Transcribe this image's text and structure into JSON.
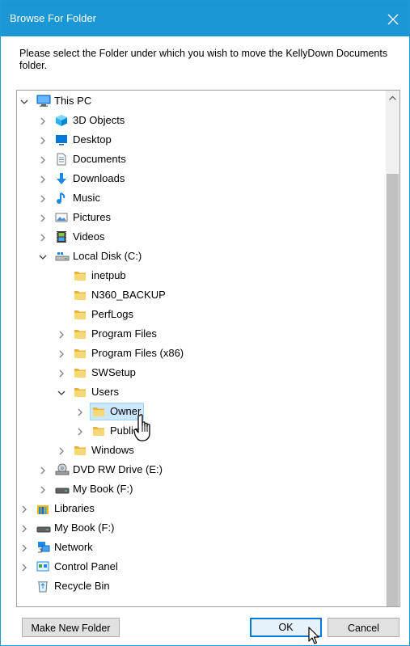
{
  "window": {
    "title": "Browse For Folder",
    "close_glyph": "✕"
  },
  "prompt": "Please select the Folder under which you wish to move the KellyDown Documents folder.",
  "tree": [
    {
      "label": "This PC",
      "level": 0,
      "state": "expanded",
      "icon": "pc-icon"
    },
    {
      "label": "3D Objects",
      "level": 1,
      "state": "collapsed",
      "icon": "3d-objects-icon"
    },
    {
      "label": "Desktop",
      "level": 1,
      "state": "collapsed",
      "icon": "desktop-icon"
    },
    {
      "label": "Documents",
      "level": 1,
      "state": "collapsed",
      "icon": "documents-icon"
    },
    {
      "label": "Downloads",
      "level": 1,
      "state": "collapsed",
      "icon": "downloads-icon"
    },
    {
      "label": "Music",
      "level": 1,
      "state": "collapsed",
      "icon": "music-icon"
    },
    {
      "label": "Pictures",
      "level": 1,
      "state": "collapsed",
      "icon": "pictures-icon"
    },
    {
      "label": "Videos",
      "level": 1,
      "state": "collapsed",
      "icon": "videos-icon"
    },
    {
      "label": "Local Disk (C:)",
      "level": 1,
      "state": "expanded",
      "icon": "local-disk-icon"
    },
    {
      "label": "inetpub",
      "level": 2,
      "state": "none",
      "icon": "folder-icon"
    },
    {
      "label": "N360_BACKUP",
      "level": 2,
      "state": "none",
      "icon": "folder-icon"
    },
    {
      "label": "PerfLogs",
      "level": 2,
      "state": "none",
      "icon": "folder-icon"
    },
    {
      "label": "Program Files",
      "level": 2,
      "state": "collapsed",
      "icon": "folder-icon"
    },
    {
      "label": "Program Files (x86)",
      "level": 2,
      "state": "collapsed",
      "icon": "folder-icon"
    },
    {
      "label": "SWSetup",
      "level": 2,
      "state": "collapsed",
      "icon": "folder-icon"
    },
    {
      "label": "Users",
      "level": 2,
      "state": "expanded",
      "icon": "folder-icon"
    },
    {
      "label": "Owner",
      "level": 3,
      "state": "collapsed",
      "icon": "folder-icon",
      "selected": true
    },
    {
      "label": "Public",
      "level": 3,
      "state": "collapsed",
      "icon": "folder-icon"
    },
    {
      "label": "Windows",
      "level": 2,
      "state": "collapsed",
      "icon": "folder-icon"
    },
    {
      "label": "DVD RW Drive (E:)",
      "level": 1,
      "state": "collapsed",
      "icon": "dvd-drive-icon"
    },
    {
      "label": "My Book (F:)",
      "level": 1,
      "state": "collapsed",
      "icon": "external-drive-icon"
    },
    {
      "label": "Libraries",
      "level": 0,
      "state": "collapsed",
      "icon": "libraries-icon"
    },
    {
      "label": "My Book (F:)",
      "level": 0,
      "state": "collapsed",
      "icon": "external-drive-icon"
    },
    {
      "label": "Network",
      "level": 0,
      "state": "collapsed",
      "icon": "network-icon"
    },
    {
      "label": "Control Panel",
      "level": 0,
      "state": "collapsed",
      "icon": "control-panel-icon"
    },
    {
      "label": "Recycle Bin",
      "level": 0,
      "state": "none",
      "icon": "recycle-bin-icon"
    }
  ],
  "buttons": {
    "make_new_folder": "Make New Folder",
    "ok": "OK",
    "cancel": "Cancel"
  },
  "colors": {
    "titlebar": "#1c97d6",
    "selection": "#cce8ff",
    "folder": "#f8d775"
  }
}
